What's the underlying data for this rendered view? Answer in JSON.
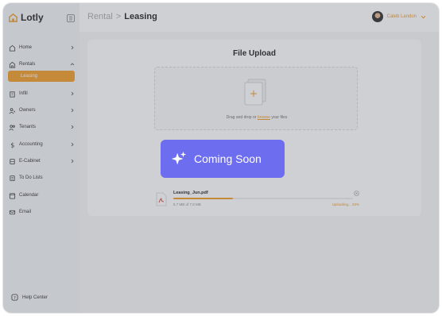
{
  "app": {
    "name": "Lotly"
  },
  "colors": {
    "accent": "#f19a21",
    "badge": "#6d6df0"
  },
  "breadcrumb": {
    "parent": "Rental",
    "separator": ">",
    "current": "Leasing"
  },
  "user": {
    "name": "Caleb Landon"
  },
  "sidebar": {
    "items": [
      {
        "label": "Home",
        "icon": "home-icon"
      },
      {
        "label": "Rentals",
        "icon": "house-icon",
        "sub": "Leasing"
      },
      {
        "label": "Infill",
        "icon": "building-icon"
      },
      {
        "label": "Owners",
        "icon": "users-icon"
      },
      {
        "label": "Tenants",
        "icon": "user-group-icon"
      },
      {
        "label": "Accounting",
        "icon": "dollar-icon"
      },
      {
        "label": "E-Cabinet",
        "icon": "cabinet-icon"
      },
      {
        "label": "To Do Lists",
        "icon": "list-icon"
      },
      {
        "label": "Calendar",
        "icon": "calendar-icon"
      },
      {
        "label": "Email",
        "icon": "mail-icon"
      }
    ],
    "help": "Help Center"
  },
  "upload": {
    "title": "File Upload",
    "drop_prefix": "Drag and drop or ",
    "drop_link": "browse",
    "drop_suffix": " your files",
    "files": [
      {
        "name": "Leasing_Jun.pdf",
        "size": "5.7 MB of 7.8 MB",
        "status": "Uploading... 33%",
        "progress": 0.33
      }
    ]
  },
  "overlay": {
    "text": "Coming Soon"
  }
}
